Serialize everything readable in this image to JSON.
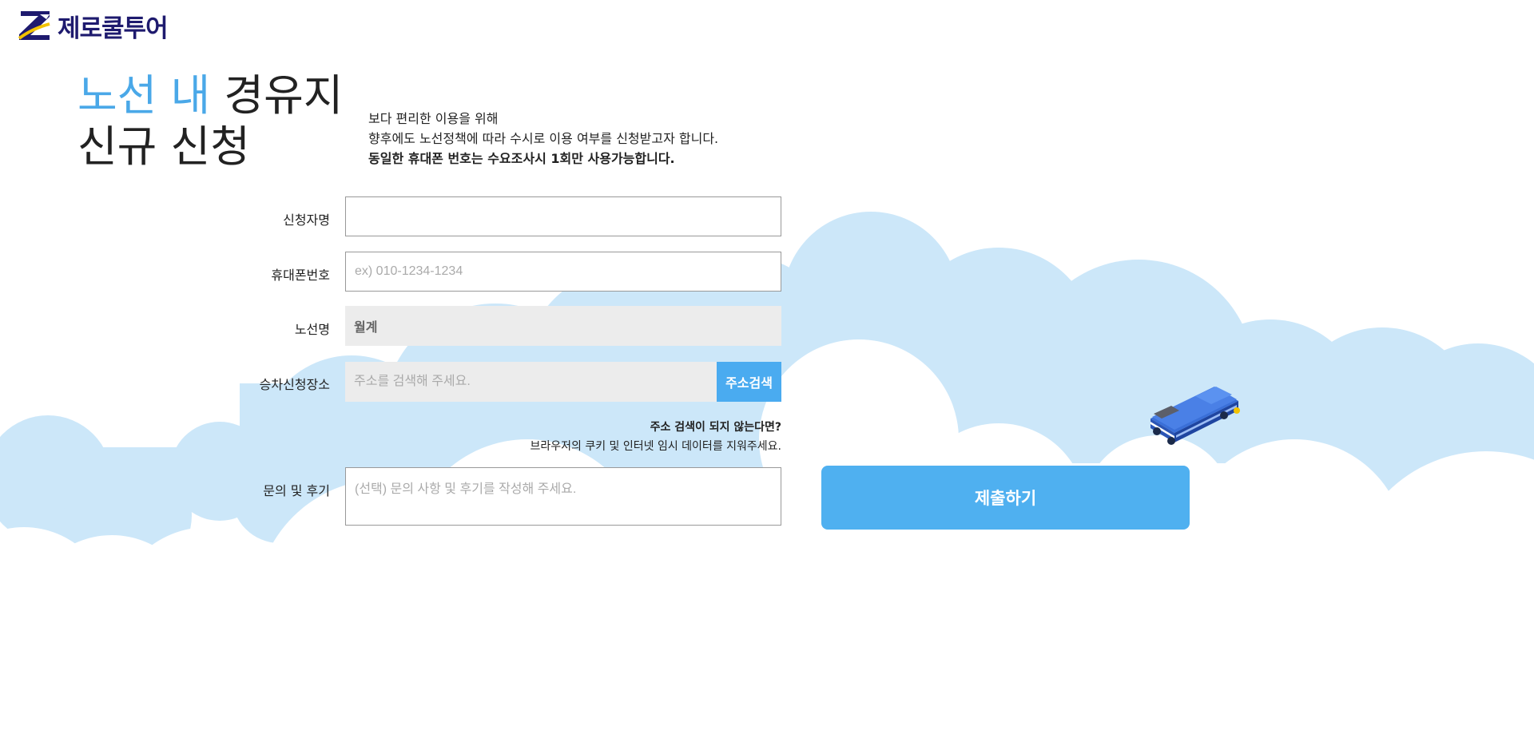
{
  "brand": {
    "logo_text": "제로쿨투어",
    "navy": "#1e1a6e",
    "yellow": "#f2c200"
  },
  "heading": {
    "line1_highlight": "노선 내",
    "line1_rest": "경유지",
    "line2": "신규 신청"
  },
  "intro": {
    "line1": "보다 편리한 이용을 위해",
    "line2": "향후에도 노선정책에 따라 수시로 이용 여부를 신청받고자 합니다.",
    "line3": "동일한 휴대폰 번호는 수요조사시 1회만 사용가능합니다."
  },
  "form": {
    "name_label": "신청자명",
    "name_value": "",
    "phone_label": "휴대폰번호",
    "phone_placeholder": "ex) 010-1234-1234",
    "route_label": "노선명",
    "route_value": "월계",
    "pickup_label": "승차신청장소",
    "pickup_placeholder": "주소를 검색해 주세요.",
    "address_search_button": "주소검색",
    "help_line1": "주소 검색이 되지 않는다면?",
    "help_line2": "브라우저의 쿠키 및 인터넷 임시 데이터를 지워주세요.",
    "inquiry_label": "문의 및 후기",
    "inquiry_placeholder": "(선택) 문의 사항 및 후기를 작성해 주세요.",
    "submit_label": "제출하기"
  },
  "colors": {
    "accent": "#4aa8e8",
    "button": "#4fb0f0",
    "cloud": "#cce7f9",
    "field_gray": "#ececec"
  },
  "icons": {
    "logo": "zerocool-z-logo-icon",
    "bus": "bus-illustration-icon"
  }
}
